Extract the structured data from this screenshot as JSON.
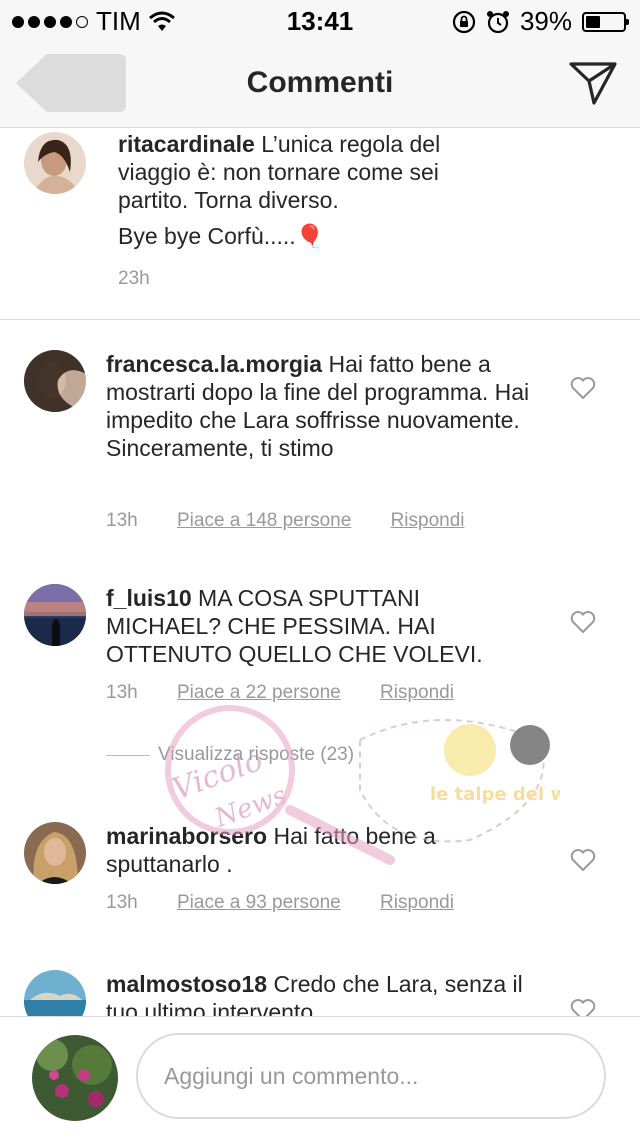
{
  "status_bar": {
    "carrier": "TIM",
    "time": "13:41",
    "battery": "39%",
    "battery_level": 0.39
  },
  "nav": {
    "title": "Commenti"
  },
  "caption": {
    "username": "ritacardinale",
    "text": "L’unica regola del viaggio è: non tornare come sei partito. Torna diverso.",
    "text2": "Bye bye Corfù.....🎈",
    "time": "23h"
  },
  "comments": [
    {
      "username": "francesca.la.morgia",
      "text": "Hai fatto bene a mostrarti dopo la fine del programma. Hai impedito che Lara soffrisse nuovamente. Sinceramente, ti stimo",
      "time": "13h",
      "likes": "Piace a 148 persone",
      "reply": "Rispondi"
    },
    {
      "username": "f_luis10",
      "text": "MA COSA SPUTTANI MICHAEL? CHE PESSIMA. HAI OTTENUTO QUELLO CHE VOLEVI.",
      "time": "13h",
      "likes": "Piace a 22 persone",
      "reply": "Rispondi",
      "view_replies": "Visualizza risposte (23)"
    },
    {
      "username": "marinaborsero",
      "text": "Hai fatto bene a sputtanarlo .",
      "time": "13h",
      "likes": "Piace a 93 persone",
      "reply": "Rispondi"
    },
    {
      "username": "malmostoso18",
      "text": "Credo che Lara, senza il tuo ultimo intervento",
      "time": "",
      "likes": "",
      "reply": ""
    }
  ],
  "input": {
    "placeholder": "Aggiungi un commento..."
  },
  "watermark": {
    "text1": "Vicolo delle News",
    "text2": "le talpe del web"
  }
}
